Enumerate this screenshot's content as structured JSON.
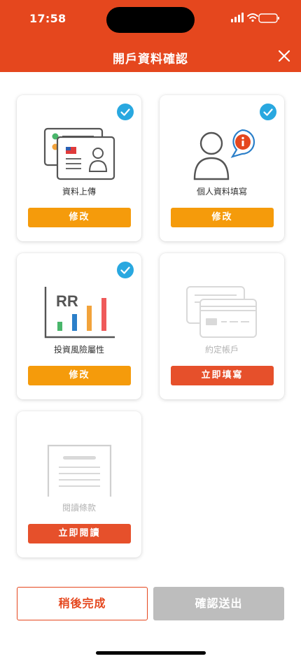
{
  "status_bar": {
    "time": "17:58"
  },
  "header": {
    "title": "開戶資料確認",
    "close_icon": "close-icon"
  },
  "colors": {
    "brand": "#e5471e",
    "edit_button": "#f59b0b",
    "action_button": "#e6502b",
    "check": "#29a8e0",
    "disabled": "#bdbdbd"
  },
  "cards": [
    {
      "label": "資料上傳",
      "button": "修改",
      "completed": true,
      "icon": "id-documents-icon"
    },
    {
      "label": "個人資料填寫",
      "button": "修改",
      "completed": true,
      "icon": "person-info-icon"
    },
    {
      "label": "投資風險屬性",
      "button": "修改",
      "completed": true,
      "icon": "risk-bar-chart-icon",
      "icon_text": "RR"
    },
    {
      "label": "約定帳戶",
      "button": "立即填寫",
      "completed": false,
      "icon": "bank-card-icon"
    },
    {
      "label": "閱讀條款",
      "button": "立即閱讀",
      "completed": false,
      "icon": "document-icon"
    }
  ],
  "footer": {
    "later_label": "稍後完成",
    "submit_label": "確認送出"
  }
}
